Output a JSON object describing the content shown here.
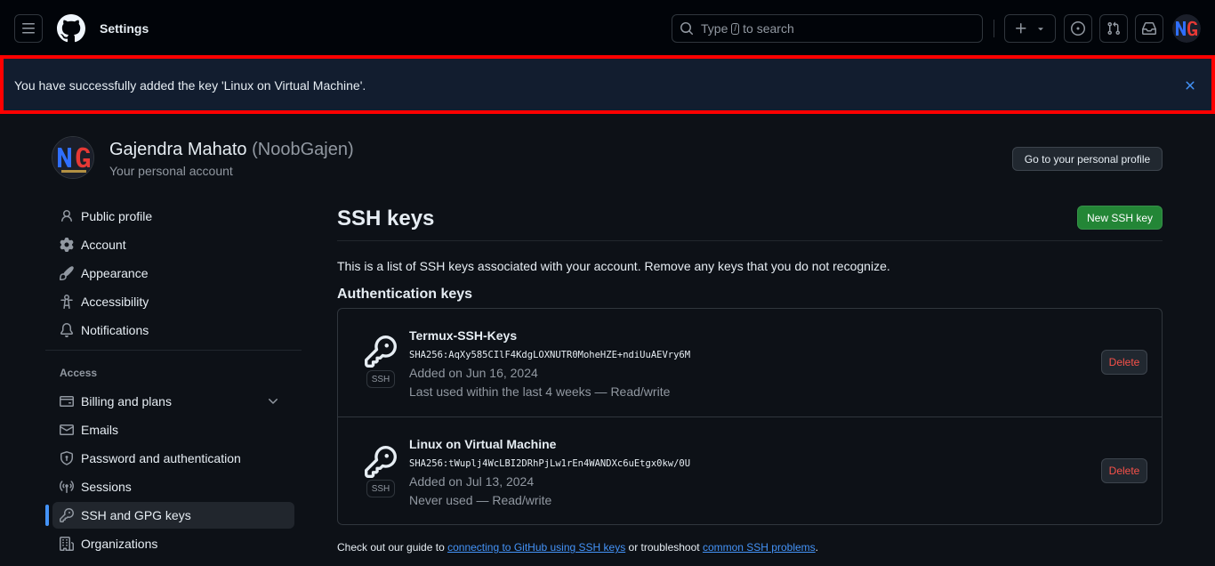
{
  "header": {
    "context": "Settings",
    "search": {
      "before": "Type",
      "key": "/",
      "after": "to search"
    },
    "icons": [
      "menu-icon",
      "github-logo",
      "search-icon",
      "plus-icon",
      "triangle-down-icon",
      "issue-icon",
      "pull-request-icon",
      "inbox-icon"
    ]
  },
  "flash": {
    "message": "You have successfully added the key 'Linux on Virtual Machine'."
  },
  "account": {
    "name": "Gajendra Mahato",
    "login": "(NoobGajen)",
    "subtitle": "Your personal account",
    "profile_button": "Go to your personal profile"
  },
  "sidebar": {
    "items": [
      {
        "label": "Public profile",
        "icon": "person-icon"
      },
      {
        "label": "Account",
        "icon": "gear-icon"
      },
      {
        "label": "Appearance",
        "icon": "paintbrush-icon"
      },
      {
        "label": "Accessibility",
        "icon": "accessibility-icon"
      },
      {
        "label": "Notifications",
        "icon": "bell-icon"
      }
    ],
    "access_heading": "Access",
    "access_items": [
      {
        "label": "Billing and plans",
        "icon": "credit-card-icon"
      },
      {
        "label": "Emails",
        "icon": "mail-icon"
      },
      {
        "label": "Password and authentication",
        "icon": "shield-lock-icon"
      },
      {
        "label": "Sessions",
        "icon": "broadcast-icon"
      },
      {
        "label": "SSH and GPG keys",
        "icon": "key-icon",
        "active": true
      },
      {
        "label": "Organizations",
        "icon": "organization-icon"
      }
    ]
  },
  "main": {
    "title": "SSH keys",
    "new_button": "New SSH key",
    "description": "This is a list of SSH keys associated with your account. Remove any keys that you do not recognize.",
    "section_title": "Authentication keys",
    "keys": [
      {
        "title": "Termux-SSH-Keys",
        "fingerprint": "SHA256:AqXy585CIlF4KdgLOXNUTR0MoheHZE+ndiUuAEVry6M",
        "added": "Added on Jun 16, 2024",
        "usage": "Last used within the last 4 weeks — Read/write",
        "badge": "SSH",
        "delete_label": "Delete"
      },
      {
        "title": "Linux on Virtual Machine",
        "fingerprint": "SHA256:tWuplj4WcLBI2DRhPjLw1rEn4WANDXc6uEtgx0kw/0U",
        "added": "Added on Jul 13, 2024",
        "usage": "Never used — Read/write",
        "badge": "SSH",
        "delete_label": "Delete"
      }
    ],
    "footer": {
      "prefix": "Check out our guide to",
      "link1": "connecting to GitHub using SSH keys",
      "middle": "or troubleshoot",
      "link2": "common SSH problems",
      "suffix": "."
    }
  },
  "colors": {
    "background": "#0d1117",
    "header": "#010409",
    "accent": "#4493f8",
    "primary_button": "#238636",
    "danger": "#f85149",
    "flash_border": "#ff0000"
  }
}
